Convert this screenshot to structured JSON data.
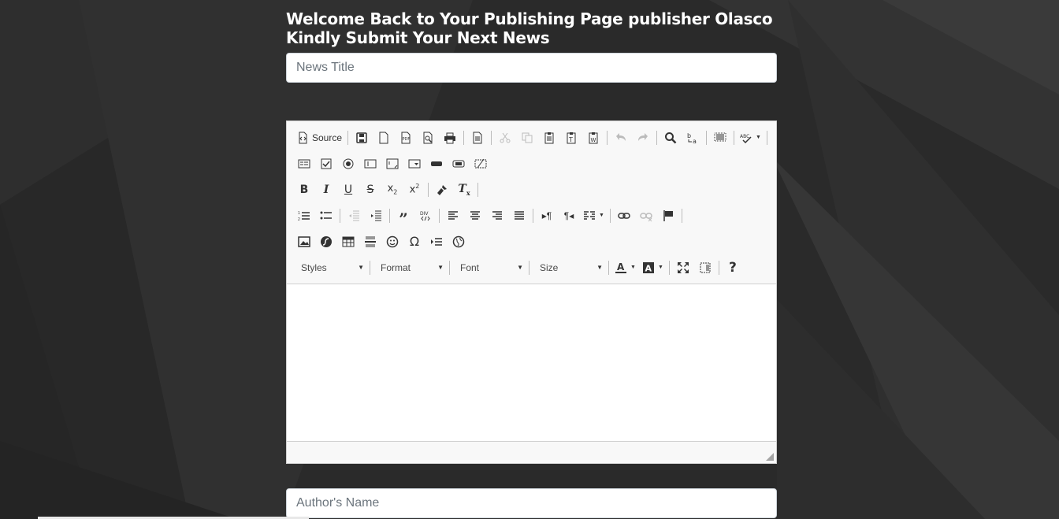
{
  "heading": "Welcome Back to Your Publishing Page publisher Olasco Kindly Submit Your Next News",
  "news_title": {
    "placeholder": "News Title",
    "value": ""
  },
  "author_name": {
    "placeholder": "Author's Name",
    "value": ""
  },
  "editor": {
    "source_label": "Source",
    "combos": {
      "styles": "Styles",
      "format": "Format",
      "font": "Font",
      "size": "Size"
    },
    "help_label": "?",
    "body_text": ""
  },
  "colors": {
    "page_bg": "#2b2b2b",
    "toolbar_bg": "#f8f8f8",
    "input_border": "#ced4da"
  }
}
